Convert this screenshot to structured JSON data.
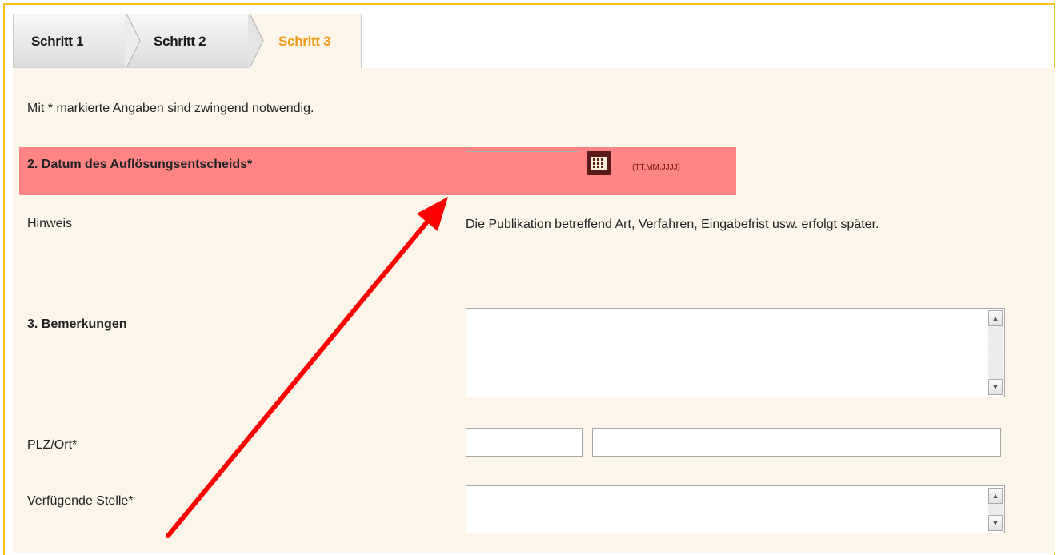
{
  "steps": [
    {
      "label": "Schritt 1",
      "state": "done"
    },
    {
      "label": "Schritt 2",
      "state": "done"
    },
    {
      "label": "Schritt 3",
      "state": "active"
    }
  ],
  "form": {
    "required_note": "Mit * markierte Angaben sind zwingend notwendig.",
    "date_field": {
      "label": "2. Datum des Auflösungsentscheids*",
      "value": "",
      "format_hint": "(TT.MM.JJJJ)",
      "state": "error"
    },
    "hint": {
      "label": "Hinweis",
      "text": "Die Publikation betreffend Art, Verfahren, Eingabefrist usw. erfolgt später."
    },
    "remarks": {
      "label": "3. Bemerkungen",
      "value": ""
    },
    "plz_ort": {
      "label": "PLZ/Ort*",
      "plz_value": "",
      "ort_value": ""
    },
    "verfuegende_stelle": {
      "label": "Verfügende Stelle*",
      "value": ""
    }
  },
  "colors": {
    "frame_border": "#f3c020",
    "content_bg": "#fbf6e9",
    "error_highlight": "#ff8585",
    "active_step": "#f29a1a",
    "annotation_arrow": "#ff0000"
  },
  "icons": {
    "calendar": "calendar-icon",
    "scroll_up": "scroll-up-arrow",
    "scroll_down": "scroll-down-arrow"
  }
}
